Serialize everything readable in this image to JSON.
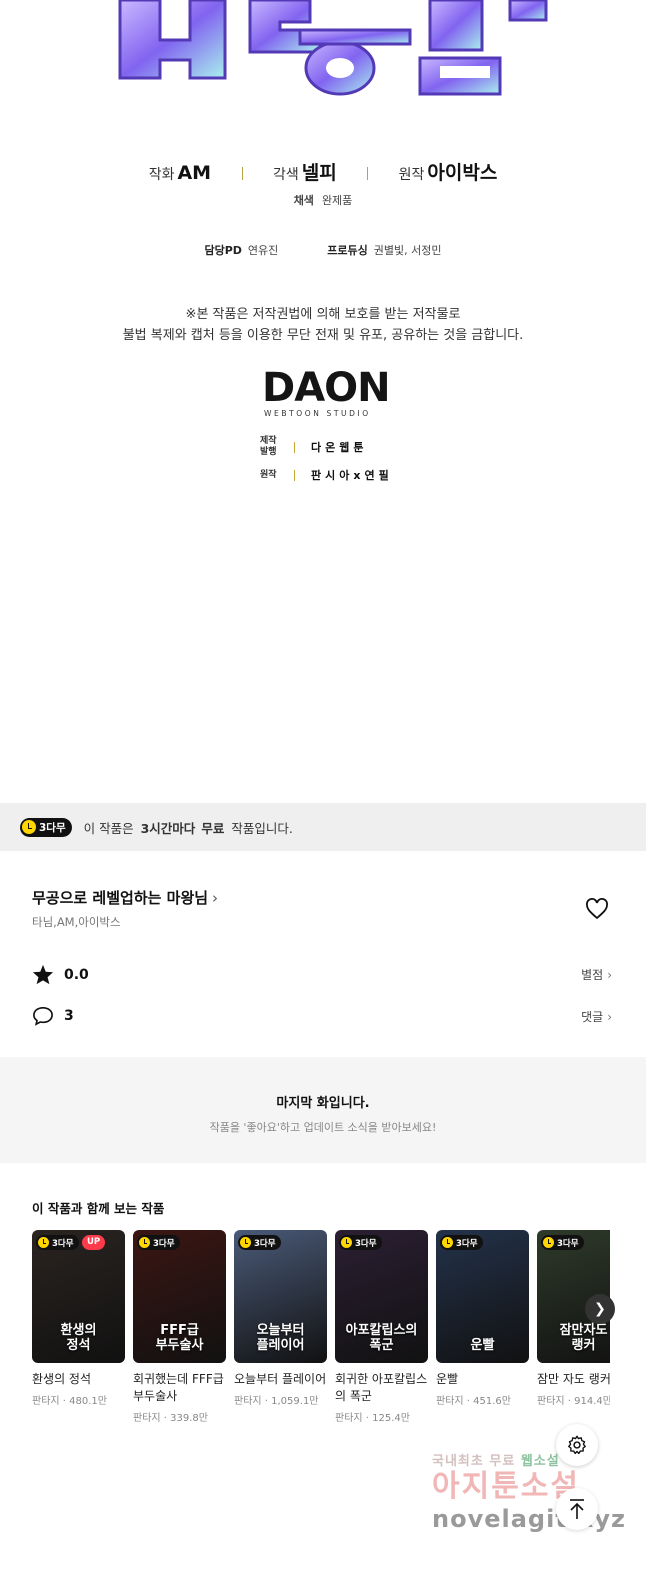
{
  "credits": {
    "art_label": "작화",
    "art_value": "AM",
    "adapt_label": "각색",
    "adapt_value": "넬피",
    "orig_label": "원작",
    "orig_value": "아이박스",
    "color_label": "채색",
    "color_value": "완제품",
    "pd_label": "담당PD",
    "pd_value": "연유진",
    "producing_label": "프로듀싱",
    "producing_value": "권별빛, 서정민"
  },
  "notice": {
    "line1": "※본 작품은 저작권법에 의해 보호를 받는 저작물로",
    "line2": "불법 복제와 캡처 등을 이용한 무단 전재 및 유포, 공유하는 것을 금합니다."
  },
  "studio": {
    "logo": "DAON",
    "sub": "WEBTOON STUDIO",
    "make_label_1": "제작",
    "make_label_2": "발행",
    "make_value": "다온웹툰",
    "orig_label": "원작",
    "orig_value": "판시아x연필"
  },
  "free_banner": {
    "badge": "3다무",
    "pre": "이 작품은",
    "bold1": "3시간마다",
    "bold2": "무료",
    "post": "작품입니다."
  },
  "work": {
    "title": "무공으로 레벨업하는 마왕님",
    "authors": "타님,AM,아이박스",
    "rating": "0.0",
    "rating_link": "별점",
    "comments": "3",
    "comments_link": "댓글"
  },
  "last_episode": {
    "heading": "마지막 화입니다.",
    "sub": "작품을 '좋아요'하고 업데이트 소식을 받아보세요!"
  },
  "recommend": {
    "heading": "이 작품과 함께 보는 작품",
    "items": [
      {
        "badge": "3다무",
        "up": "UP",
        "title": "환생의 정석",
        "meta": "판타지 · 480.1만",
        "cap": "환생의\n정석",
        "color": "#2a2420"
      },
      {
        "badge": "3다무",
        "title": "회귀했는데 FFF급 부두술사",
        "meta": "판타지 · 339.8만",
        "cap": "FFF급\n부두술사",
        "color": "#3b1612"
      },
      {
        "badge": "3다무",
        "title": "오늘부터 플레이어",
        "meta": "판타지 · 1,059.1만",
        "cap": "오늘부터\n플레이어",
        "color": "#4a5a78"
      },
      {
        "badge": "3다무",
        "title": "회귀한 아포칼립스의 폭군",
        "meta": "판타지 · 125.4만",
        "cap": "아포칼립스의\n폭군",
        "color": "#2b1f33"
      },
      {
        "badge": "3다무",
        "title": "운빨",
        "meta": "판타지 · 451.6만",
        "cap": "운빨",
        "color": "#23324a"
      },
      {
        "badge": "3다무",
        "title": "잠만 자도 랭커",
        "meta": "판타지 · 914.4만",
        "cap": "잠만자도\n랭커",
        "color": "#2e3a2a"
      }
    ]
  },
  "watermark": {
    "line1a": "국내최초 무료",
    "line1b": "웹소설",
    "line2": "아지툰소설",
    "line3": "novelagit.xyz"
  }
}
